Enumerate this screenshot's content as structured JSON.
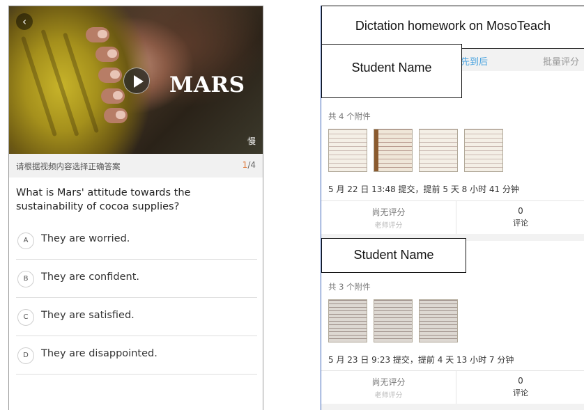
{
  "quiz": {
    "video": {
      "brand": "MARS",
      "speed_label": "慢",
      "back_glyph": "‹"
    },
    "instruction": "请根据视频内容选择正确答案",
    "progress": {
      "current": "1",
      "total": "/4"
    },
    "question": "What is Mars' attitude towards the sustainability of cocoa supplies?",
    "options": [
      {
        "letter": "A",
        "text": "They are worried."
      },
      {
        "letter": "B",
        "text": "They are confident."
      },
      {
        "letter": "C",
        "text": "They are satisfied."
      },
      {
        "letter": "D",
        "text": "They are disappointed."
      }
    ]
  },
  "homework": {
    "title": "Dictation homework on MosoTeach",
    "tabs": {
      "sort": "先到后",
      "batch": "批量评分"
    },
    "submissions": [
      {
        "student_label": "Student Name",
        "attachments_label": "共 4 个附件",
        "submit_time": "5 月 22 日 13:48 提交，提前 5 天 8 小时 41 分钟",
        "score_status": "尚无评分",
        "score_sub": "老师评分",
        "comment_count": "0",
        "comment_label": "评论"
      },
      {
        "student_label": "Student Name",
        "attachments_label": "共 3 个附件",
        "submit_time": "5 月 23 日 9:23 提交，提前 4 天 13 小时 7 分钟",
        "score_status": "尚无评分",
        "score_sub": "老师评分",
        "comment_count": "0",
        "comment_label": "评论"
      }
    ]
  },
  "colors": {
    "accent_blue": "#4aa3df",
    "progress_orange": "#e07a3a",
    "panel_gray": "#f2f2f2"
  }
}
